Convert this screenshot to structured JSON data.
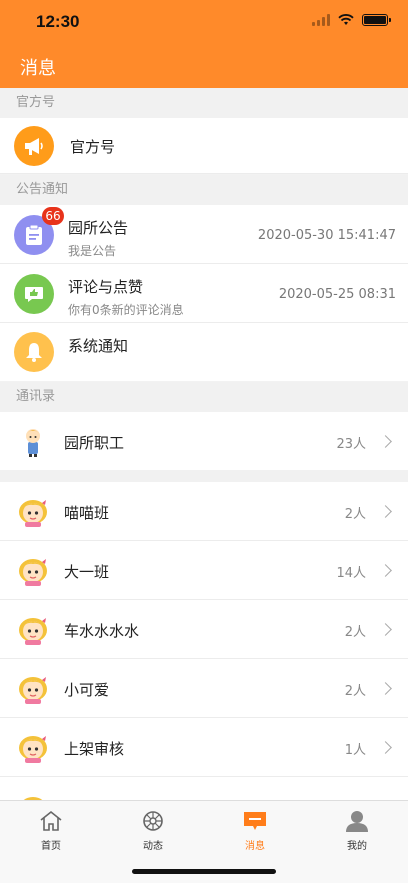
{
  "status_bar": {
    "time": "12:30"
  },
  "nav": {
    "title": "消息"
  },
  "sections": {
    "official": "官方号",
    "notices": "公告通知",
    "contacts": "通讯录"
  },
  "official_account": {
    "title": "官方号",
    "icon": "megaphone-icon"
  },
  "notices": [
    {
      "title": "园所公告",
      "subtitle": "我是公告",
      "time": "2020-05-30 15:41:47",
      "badge": "66",
      "icon": "clipboard-icon",
      "color": "#8f8ff0"
    },
    {
      "title": "评论与点赞",
      "subtitle": "你有0条新的评论消息",
      "time": "2020-05-25 08:31",
      "icon": "thumbs-up-icon",
      "color": "#78c850"
    },
    {
      "title": "系统通知",
      "icon": "bell-icon",
      "color": "#ffc14d"
    }
  ],
  "staff": {
    "title": "园所职工",
    "count": "23人"
  },
  "classes": [
    {
      "name": "喵喵班",
      "count": "2人"
    },
    {
      "name": "大一班",
      "count": "14人"
    },
    {
      "name": "车水水水水",
      "count": "2人"
    },
    {
      "name": "小可爱",
      "count": "2人"
    },
    {
      "name": "上架审核",
      "count": "1人"
    }
  ],
  "tabbar": {
    "items": [
      {
        "label": "首页",
        "icon": "home-icon"
      },
      {
        "label": "动态",
        "icon": "wheel-icon"
      },
      {
        "label": "消息",
        "icon": "message-icon"
      },
      {
        "label": "我的",
        "icon": "profile-icon"
      }
    ],
    "active_color": "#ff7d1a"
  },
  "colors": {
    "brand": "#ff8a2a",
    "badge": "#e8331b"
  }
}
